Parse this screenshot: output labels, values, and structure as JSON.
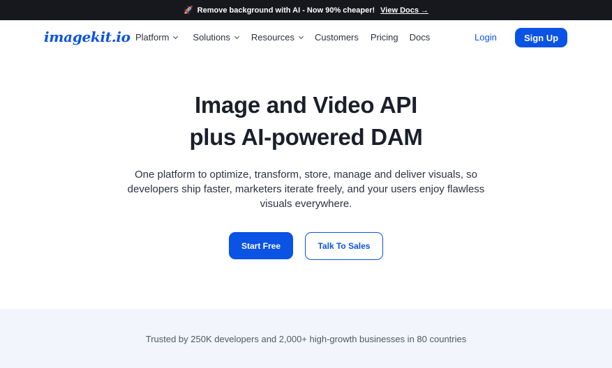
{
  "announcement": {
    "icon": "rocket-icon",
    "icon_glyph": "🚀",
    "text": "Remove background with AI - Now 90% cheaper!",
    "link_label": "View Docs →"
  },
  "nav": {
    "logo": "imagekit.io",
    "items": [
      {
        "label": "Platform",
        "dropdown": true
      },
      {
        "label": "Solutions",
        "dropdown": true
      },
      {
        "label": "Resources",
        "dropdown": true
      },
      {
        "label": "Customers",
        "dropdown": false
      },
      {
        "label": "Pricing",
        "dropdown": false
      },
      {
        "label": "Docs",
        "dropdown": false
      }
    ],
    "login_label": "Login",
    "signup_label": "Sign Up"
  },
  "hero": {
    "title_line1": "Image and Video API",
    "title_line2": "plus AI-powered DAM",
    "subtitle": "One platform to optimize, transform, store, manage and deliver visuals, so developers ship faster, marketers iterate freely, and your users enjoy flawless visuals everywhere.",
    "primary_cta": "Start Free",
    "secondary_cta": "Talk To Sales"
  },
  "trust": {
    "text": "Trusted by 250K developers and 2,000+ high-growth businesses in 80 countries"
  },
  "colors": {
    "brand_blue": "#0a53e4",
    "announcement_bg": "#16181d",
    "trust_bg": "#f2f5fb"
  }
}
